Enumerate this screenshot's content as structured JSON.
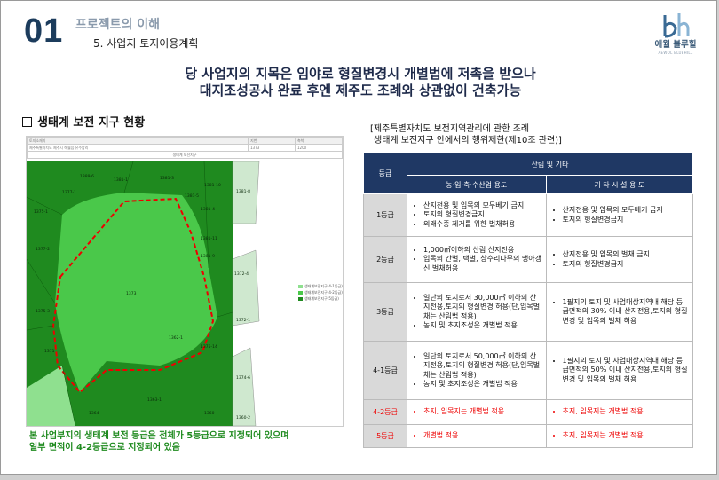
{
  "header": {
    "section_number": "01",
    "section_title": "프로젝트의 이해",
    "subsection": "5. 사업지 토지이용계획"
  },
  "logo": {
    "name": "애월 블루힐",
    "sub": "AEWOL BLUEHILL",
    "brand_color": "#3a6a94"
  },
  "headline": {
    "line1": "당 사업지의 지목은 임야로 형질변경시 개별법에 저촉을 받으나",
    "line2": "대지조성공사 완료 후엔 제주도 조례와 상관없이 건축가능"
  },
  "eco_map": {
    "title": "생태계 보전 지구 현황",
    "table_header": [
      "토지소재지",
      "지번",
      "축척"
    ],
    "table_row": [
      "제주특별자치도 제주시 애월읍 유수암리",
      "1373",
      "1200"
    ],
    "map_caption": "생태계 보전지구",
    "parcels": [
      "1389-6",
      "1381-1",
      "1381-3",
      "1377-1",
      "1381-5",
      "1381-10",
      "1381-4",
      "1375-1",
      "1381-8",
      "1381-11",
      "1377-2",
      "1381-9",
      "1373",
      "1375-3",
      "1372-4",
      "1362-1",
      "1371",
      "1375-14",
      "1372-1",
      "1363-1",
      "1364",
      "1360",
      "1374-6",
      "1360-2"
    ],
    "legend": [
      "생태계보전지구(4-1등급)",
      "생태계보전지구(4-2등급)",
      "생태계보전지구(5등급)"
    ],
    "legend_colors": [
      "#8fe08f",
      "#4ac84a",
      "#1f8a1f"
    ],
    "caption_line1": "본 사업부지의 생태계 보전 등급은 전체가 5등급으로 지정되어 있으며",
    "caption_line2": "일부 면적이 4-2등급으로 지정되어 있음"
  },
  "regulation": {
    "title_line1": "[제주특별자치도 보전지역관리에 관한 조례",
    "title_line2": "생태계 보전지구 안에서의 행위제한(제10조 관련)]",
    "header_grade": "등급",
    "header_group": "산림 및 기타",
    "header_col1": "농·임·축·수산업 용도",
    "header_col2": "기 타 시 설 용 도",
    "rows": [
      {
        "grade": "1등급",
        "red": false,
        "col1": [
          "산지전용 및 입목의 모두베기 금지",
          "토지의 형질변경금지",
          "외래수종 제거를 위한 벌채허용"
        ],
        "col2": [
          "산지전용 및 입목의 모두베기 금지",
          "토지의 형질변경금지"
        ]
      },
      {
        "grade": "2등급",
        "red": false,
        "col1": [
          "1,000㎡이하의 산림 산지전용",
          "입목의 간벌, 택벌, 상수리나무의 맹아갱신 벌채허용"
        ],
        "col2": [
          "산지전용 및 입목의 벌채 금지",
          "토지의 형질변경금지"
        ]
      },
      {
        "grade": "3등급",
        "red": false,
        "col1": [
          "일단의 토지로서 30,000㎡ 이하의 산지전용,토지의 형질변경 허용(단,입목벌채는 산림법 적용)",
          "농지 및 초지조성은 개별법 적용"
        ],
        "col2": [
          "1필지의 토지 및 사업대상지역내 해당 등급면적의 30% 이내 산지전용,토지의 형질변경 및 입목의 벌채 허용"
        ]
      },
      {
        "grade": "4-1등급",
        "red": false,
        "col1": [
          "일단의 토지로서 50,000㎡ 이하의 산지전용,토지의 형질변경 허용(단,입목벌채는 산림법 적용)",
          "농지 및 초지조성은 개별법 적용"
        ],
        "col2": [
          "1필지의 토지 및 사업대상지역내 해당 등급면적의 50% 이내 산지전용,토지의 형질변경 및 입목의 벌채 허용"
        ]
      },
      {
        "grade": "4-2등급",
        "red": true,
        "col1": [
          "초지, 임목지는 개별법 적용"
        ],
        "col2": [
          "초지, 임목지는 개별법 적용"
        ]
      },
      {
        "grade": "5등급",
        "red": true,
        "col1": [
          "개별법 적용"
        ],
        "col2": [
          "초지, 임목지는 개별법 적용"
        ]
      }
    ]
  }
}
